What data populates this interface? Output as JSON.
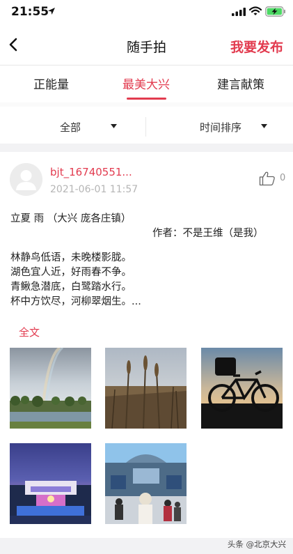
{
  "status_bar": {
    "time": "21:55"
  },
  "nav": {
    "title": "随手拍",
    "publish_label": "我要发布"
  },
  "tabs": [
    {
      "label": "正能量",
      "active": false
    },
    {
      "label": "最美大兴",
      "active": true
    },
    {
      "label": "建言献策",
      "active": false
    }
  ],
  "filters": {
    "category": "全部",
    "sort": "时间排序"
  },
  "post": {
    "username": "bjt_16740551...",
    "time": "2021-06-01 11:57",
    "likes": "0",
    "title_line": "立夏 雨 （大兴 庞各庄镇）",
    "author_line": "作者：不是王维（是我）",
    "poem_lines": [
      "林静鸟低语，未晚楼影胧。",
      "湖色宜人近，好雨春不争。",
      "青鳅急潜底，白鹭踏水行。",
      "杯中方饮尽，河柳翠烟生。..."
    ],
    "full_text_label": "全文",
    "photos": [
      "rainbow-park",
      "wheat-field",
      "bicycle-silhouette",
      "lit-stage-night",
      "building-crowd"
    ]
  },
  "watermark": "头条 @北京大兴",
  "colors": {
    "accent": "#e23b4f",
    "muted": "#b5b5b5",
    "gap": "#f2f2f4"
  }
}
